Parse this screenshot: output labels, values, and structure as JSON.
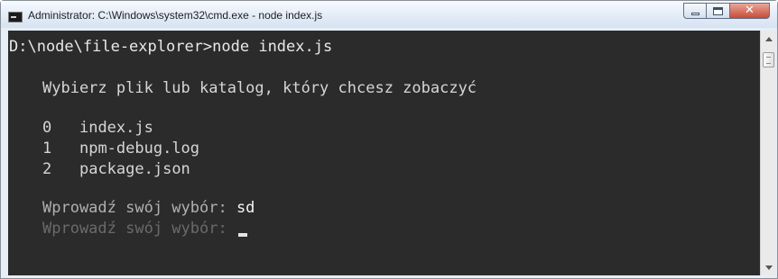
{
  "window": {
    "title": "Administrator: C:\\Windows\\system32\\cmd.exe - node  index.js",
    "icon": "cmd-icon",
    "controls": {
      "minimize": "minimize-icon",
      "maximize": "maximize-icon",
      "close": "✕"
    }
  },
  "console": {
    "prompt": "D:\\node\\file-explorer>node index.js",
    "heading": "Wybierz plik lub katalog, który chcesz zobaczyć",
    "options": [
      {
        "index": "0",
        "name": "index.js"
      },
      {
        "index": "1",
        "name": "npm-debug.log"
      },
      {
        "index": "2",
        "name": "package.json"
      }
    ],
    "input_prompt_1": "Wprowadź swój wybór: ",
    "input_value_1": "sd",
    "input_prompt_2": "Wprowadź swój wybór: "
  },
  "colors": {
    "console_bg": "#2b2b2b",
    "text": "#d6d6d6",
    "faded_prompt": "#6a6a6a",
    "close_button": "#c64b36"
  }
}
